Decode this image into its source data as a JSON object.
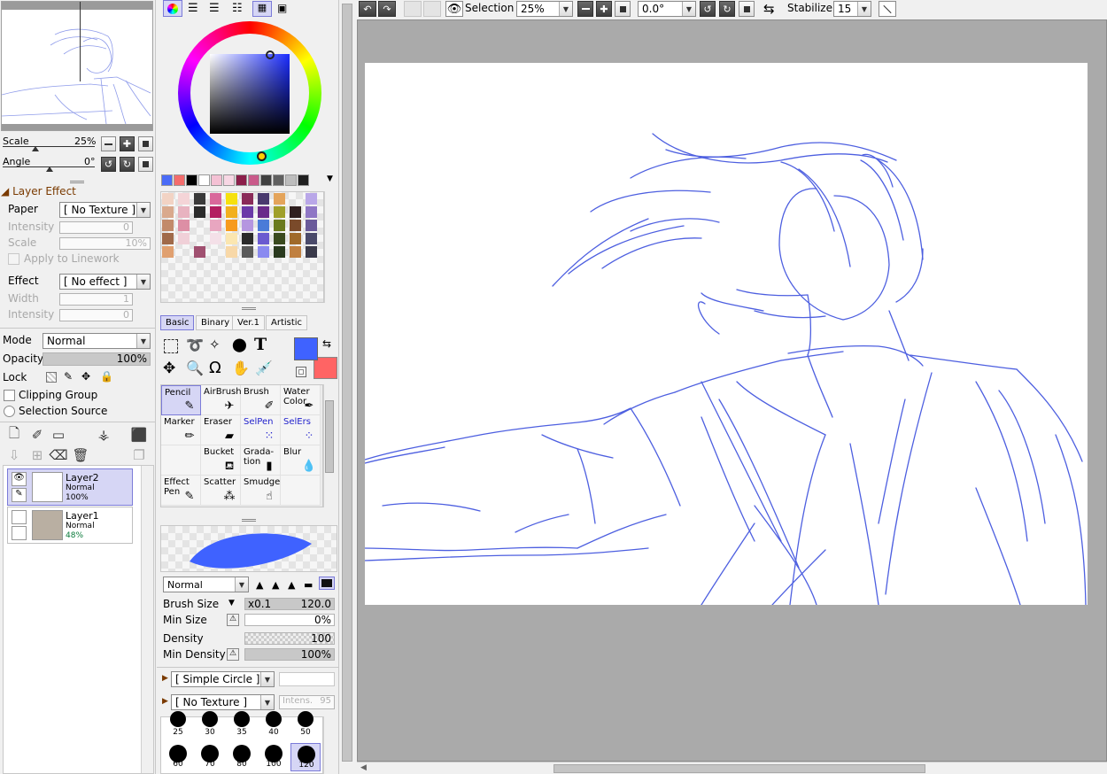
{
  "navigator": {
    "scale_label": "Scale",
    "scale_value": "25%",
    "angle_label": "Angle",
    "angle_value": "0°"
  },
  "layer_effect": {
    "section_label": "Layer Effect",
    "paper_label": "Paper",
    "paper_value": "[ No Texture ]",
    "intensity_label": "Intensity",
    "intensity_value": "0",
    "scale_label": "Scale",
    "scale_value": "10%",
    "apply_linework_label": "Apply to Linework",
    "effect_label": "Effect",
    "effect_value": "[ No effect ]",
    "width_label": "Width",
    "width_value": "1",
    "intensity2_label": "Intensity",
    "intensity2_value": "0"
  },
  "layer_props": {
    "mode_label": "Mode",
    "mode_value": "Normal",
    "opacity_label": "Opacity",
    "opacity_value": "100%",
    "lock_label": "Lock",
    "clipping_label": "Clipping Group",
    "selection_source_label": "Selection Source"
  },
  "layers": [
    {
      "name": "Layer2",
      "mode": "Normal",
      "opacity": "100%",
      "selected": true
    },
    {
      "name": "Layer1",
      "mode": "Normal",
      "opacity": "48%",
      "selected": false
    }
  ],
  "palette": {
    "top_row": [
      "#4a6cf7",
      "#f36c6c",
      "#000000",
      "#ffffff",
      "#f4c1d4",
      "#f7d7e4",
      "#8c1f4a",
      "#c95a8a",
      "#404040",
      "#606060",
      "#bdbdbd",
      "#1f1f1f"
    ],
    "grid": [
      [
        "#f2d3c4",
        "#f4d4d7",
        "#3a3a3a",
        "#d9699b",
        "#f6e10e",
        "#8a2b59",
        "#4a3a6e",
        "#e4a45b",
        "#ffffff",
        "#b9a7e8"
      ],
      [
        "#d9a98d",
        "#e8b3c0",
        "#2b2b2b",
        "#b31f61",
        "#f2b01e",
        "#6b3aa8",
        "#6a2a8a",
        "#a0a02b",
        "#2f1f1f",
        "#8f77c5"
      ],
      [
        "#c28a6a",
        "#dd8fa5",
        "#ffffff",
        "#e8a6c0",
        "#f79b1e",
        "#b596e0",
        "#4a7bd8",
        "#6a7a1e",
        "#7a4a2a",
        "#6a5a9a"
      ],
      [
        "#a06a4a",
        "#f0d0d8",
        "#ffffff",
        "#f4e0e8",
        "#fbe6b0",
        "#2a2a2a",
        "#6a5ad0",
        "#3a4a1e",
        "#a06a2a",
        "#4a4a6a"
      ],
      [
        "#e0a070",
        "#ffffff",
        "#a05070",
        "#ffffff",
        "#f8d8a8",
        "#5a5a5a",
        "#8a8af0",
        "#2a3a1e",
        "#c08040",
        "#3a3a4a"
      ]
    ]
  },
  "tool_tabs": [
    "Basic",
    "Binary",
    "Ver.1",
    "Artistic"
  ],
  "colors": {
    "primary": "#3f62ff",
    "secondary": "#ff6464"
  },
  "brush_tools": [
    {
      "label": "Pencil",
      "selected": true,
      "blue": false,
      "icon": "pencil-icon",
      "glyph": "✎"
    },
    {
      "label": "AirBrush",
      "selected": false,
      "blue": false,
      "icon": "airbrush-icon",
      "glyph": "✈"
    },
    {
      "label": "Brush",
      "selected": false,
      "blue": false,
      "icon": "brush-icon",
      "glyph": "✐"
    },
    {
      "label": "Water Color",
      "selected": false,
      "blue": false,
      "icon": "watercolor-icon",
      "glyph": "✒"
    },
    {
      "label": "Marker",
      "selected": false,
      "blue": false,
      "icon": "marker-icon",
      "glyph": "✏"
    },
    {
      "label": "Eraser",
      "selected": false,
      "blue": false,
      "icon": "eraser-icon",
      "glyph": "▰"
    },
    {
      "label": "SelPen",
      "selected": false,
      "blue": true,
      "icon": "selpen-icon",
      "glyph": "⁙"
    },
    {
      "label": "SelErs",
      "selected": false,
      "blue": true,
      "icon": "selers-icon",
      "glyph": "⁘"
    },
    {
      "label": "",
      "selected": false,
      "blue": false,
      "icon": "",
      "glyph": ""
    },
    {
      "label": "Bucket",
      "selected": false,
      "blue": false,
      "icon": "bucket-icon",
      "glyph": "⛾"
    },
    {
      "label": "Grada- tion",
      "selected": false,
      "blue": false,
      "icon": "gradation-icon",
      "glyph": "▮"
    },
    {
      "label": "Blur",
      "selected": false,
      "blue": false,
      "icon": "blur-icon",
      "glyph": "💧"
    },
    {
      "label": "Effect Pen",
      "selected": false,
      "blue": false,
      "icon": "effect-pen-icon",
      "glyph": "✎"
    },
    {
      "label": "Scatter",
      "selected": false,
      "blue": false,
      "icon": "scatter-icon",
      "glyph": "⁂"
    },
    {
      "label": "Smudge",
      "selected": false,
      "blue": false,
      "icon": "smudge-icon",
      "glyph": "☝"
    },
    {
      "label": "",
      "selected": false,
      "blue": false,
      "icon": "",
      "glyph": ""
    }
  ],
  "brush_settings": {
    "blend_mode": "Normal",
    "size_label": "Brush Size",
    "size_multiplier": "x0.1",
    "size_value": "120.0",
    "min_size_label": "Min Size",
    "min_size_value": "0%",
    "density_label": "Density",
    "density_value": "100",
    "min_density_label": "Min Density",
    "min_density_value": "100%",
    "shape_value": "[ Simple Circle ]",
    "texture_value": "[ No Texture ]",
    "texture_intensity_label": "Intens.",
    "texture_intensity_value": "95"
  },
  "brush_sizes": [
    "25",
    "30",
    "35",
    "40",
    "50",
    "60",
    "70",
    "80",
    "100",
    "120"
  ],
  "toolbar": {
    "selection_label": "Selection",
    "zoom_value": "25%",
    "rotation_value": "0.0°",
    "stabilizer_label": "Stabilizer",
    "stabilizer_value": "15"
  }
}
